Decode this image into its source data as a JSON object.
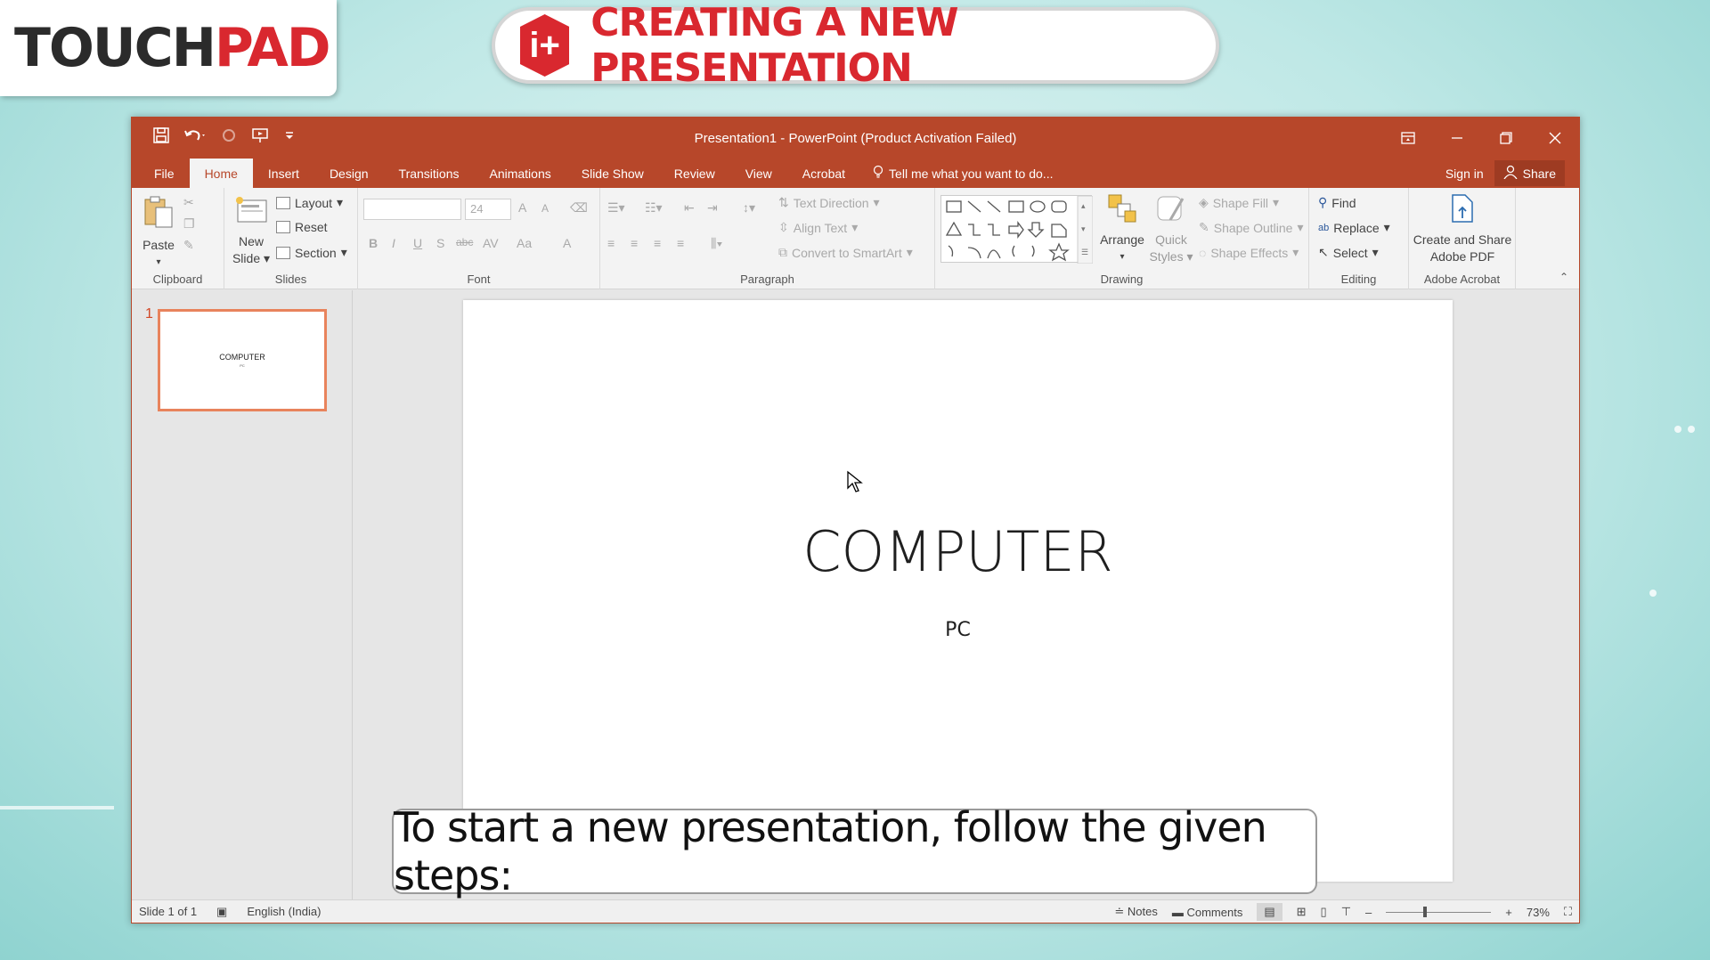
{
  "logo": {
    "part1": "TOUCH",
    "part2": "PAD"
  },
  "banner": {
    "icon_text": "i+",
    "title": "CREATING A NEW PRESENTATION"
  },
  "window": {
    "title": "Presentation1 - PowerPoint (Product Activation Failed)",
    "controls": [
      "ribbon-display-icon",
      "minimize-icon",
      "restore-icon",
      "close-icon"
    ]
  },
  "tabs": {
    "file": "File",
    "home": "Home",
    "insert": "Insert",
    "design": "Design",
    "transitions": "Transitions",
    "animations": "Animations",
    "slideshow": "Slide Show",
    "review": "Review",
    "view": "View",
    "acrobat": "Acrobat",
    "tell": "Tell me what you want to do...",
    "signin": "Sign in",
    "share": "Share"
  },
  "ribbon": {
    "clipboard": {
      "paste": "Paste",
      "label": "Clipboard"
    },
    "slides": {
      "new_slide_line1": "New",
      "new_slide_line2": "Slide",
      "layout": "Layout",
      "reset": "Reset",
      "section": "Section",
      "label": "Slides"
    },
    "font": {
      "size": "24",
      "label": "Font",
      "bold": "B",
      "italic": "I",
      "underline": "U",
      "shadow": "S",
      "strike": "abc",
      "spacing": "AV",
      "case": "Aa",
      "color": "A",
      "grow": "A",
      "shrink": "A"
    },
    "paragraph": {
      "text_direction": "Text Direction",
      "align_text": "Align Text",
      "smartart": "Convert to SmartArt",
      "label": "Paragraph"
    },
    "drawing": {
      "arrange": "Arrange",
      "quick_line1": "Quick",
      "quick_line2": "Styles",
      "shape_fill": "Shape Fill",
      "shape_outline": "Shape Outline",
      "shape_effects": "Shape Effects",
      "label": "Drawing"
    },
    "editing": {
      "find": "Find",
      "replace": "Replace",
      "select": "Select",
      "label": "Editing"
    },
    "acrobat": {
      "line1": "Create and Share",
      "line2": "Adobe PDF",
      "label": "Adobe Acrobat"
    }
  },
  "thumbnails": [
    {
      "number": "1",
      "title": "COMPUTER",
      "subtitle": "PC"
    }
  ],
  "slide": {
    "title": "COMPUTER",
    "subtitle": "PC"
  },
  "status": {
    "slide": "Slide 1 of 1",
    "language": "English (India)",
    "notes": "Notes",
    "comments": "Comments",
    "zoom": "73%",
    "zoom_level": 0.36
  },
  "caption": "To start a new presentation, follow the given steps:"
}
